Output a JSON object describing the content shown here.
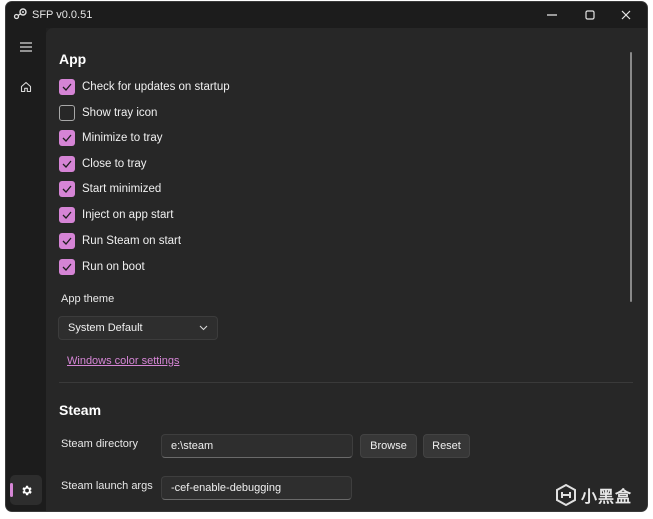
{
  "window": {
    "title": "SFP v0.0.51"
  },
  "sidebar": {
    "items": [
      {
        "icon": "hamburger-menu-icon"
      },
      {
        "icon": "home-icon"
      },
      {
        "icon": "gear-icon",
        "active": true
      }
    ]
  },
  "app_section": {
    "title": "App",
    "checkboxes": [
      {
        "label": "Check for updates on startup",
        "checked": true
      },
      {
        "label": "Show tray icon",
        "checked": false
      },
      {
        "label": "Minimize to tray",
        "checked": true
      },
      {
        "label": "Close to tray",
        "checked": true
      },
      {
        "label": "Start minimized",
        "checked": true
      },
      {
        "label": "Inject on app start",
        "checked": true
      },
      {
        "label": "Run Steam on start",
        "checked": true
      },
      {
        "label": "Run on boot",
        "checked": true
      }
    ],
    "theme_label": "App theme",
    "theme_value": "System Default",
    "color_link": "Windows color settings"
  },
  "steam_section": {
    "title": "Steam",
    "directory_label": "Steam directory",
    "directory_value": "e:\\steam",
    "browse_label": "Browse",
    "reset_label": "Reset",
    "launch_args_label": "Steam launch args",
    "launch_args_value": "-cef-enable-debugging"
  },
  "watermark": {
    "text": "小黑盒"
  },
  "colors": {
    "accent": "#d584d5",
    "background": "#272727",
    "sidebar": "#1c1c1c"
  }
}
